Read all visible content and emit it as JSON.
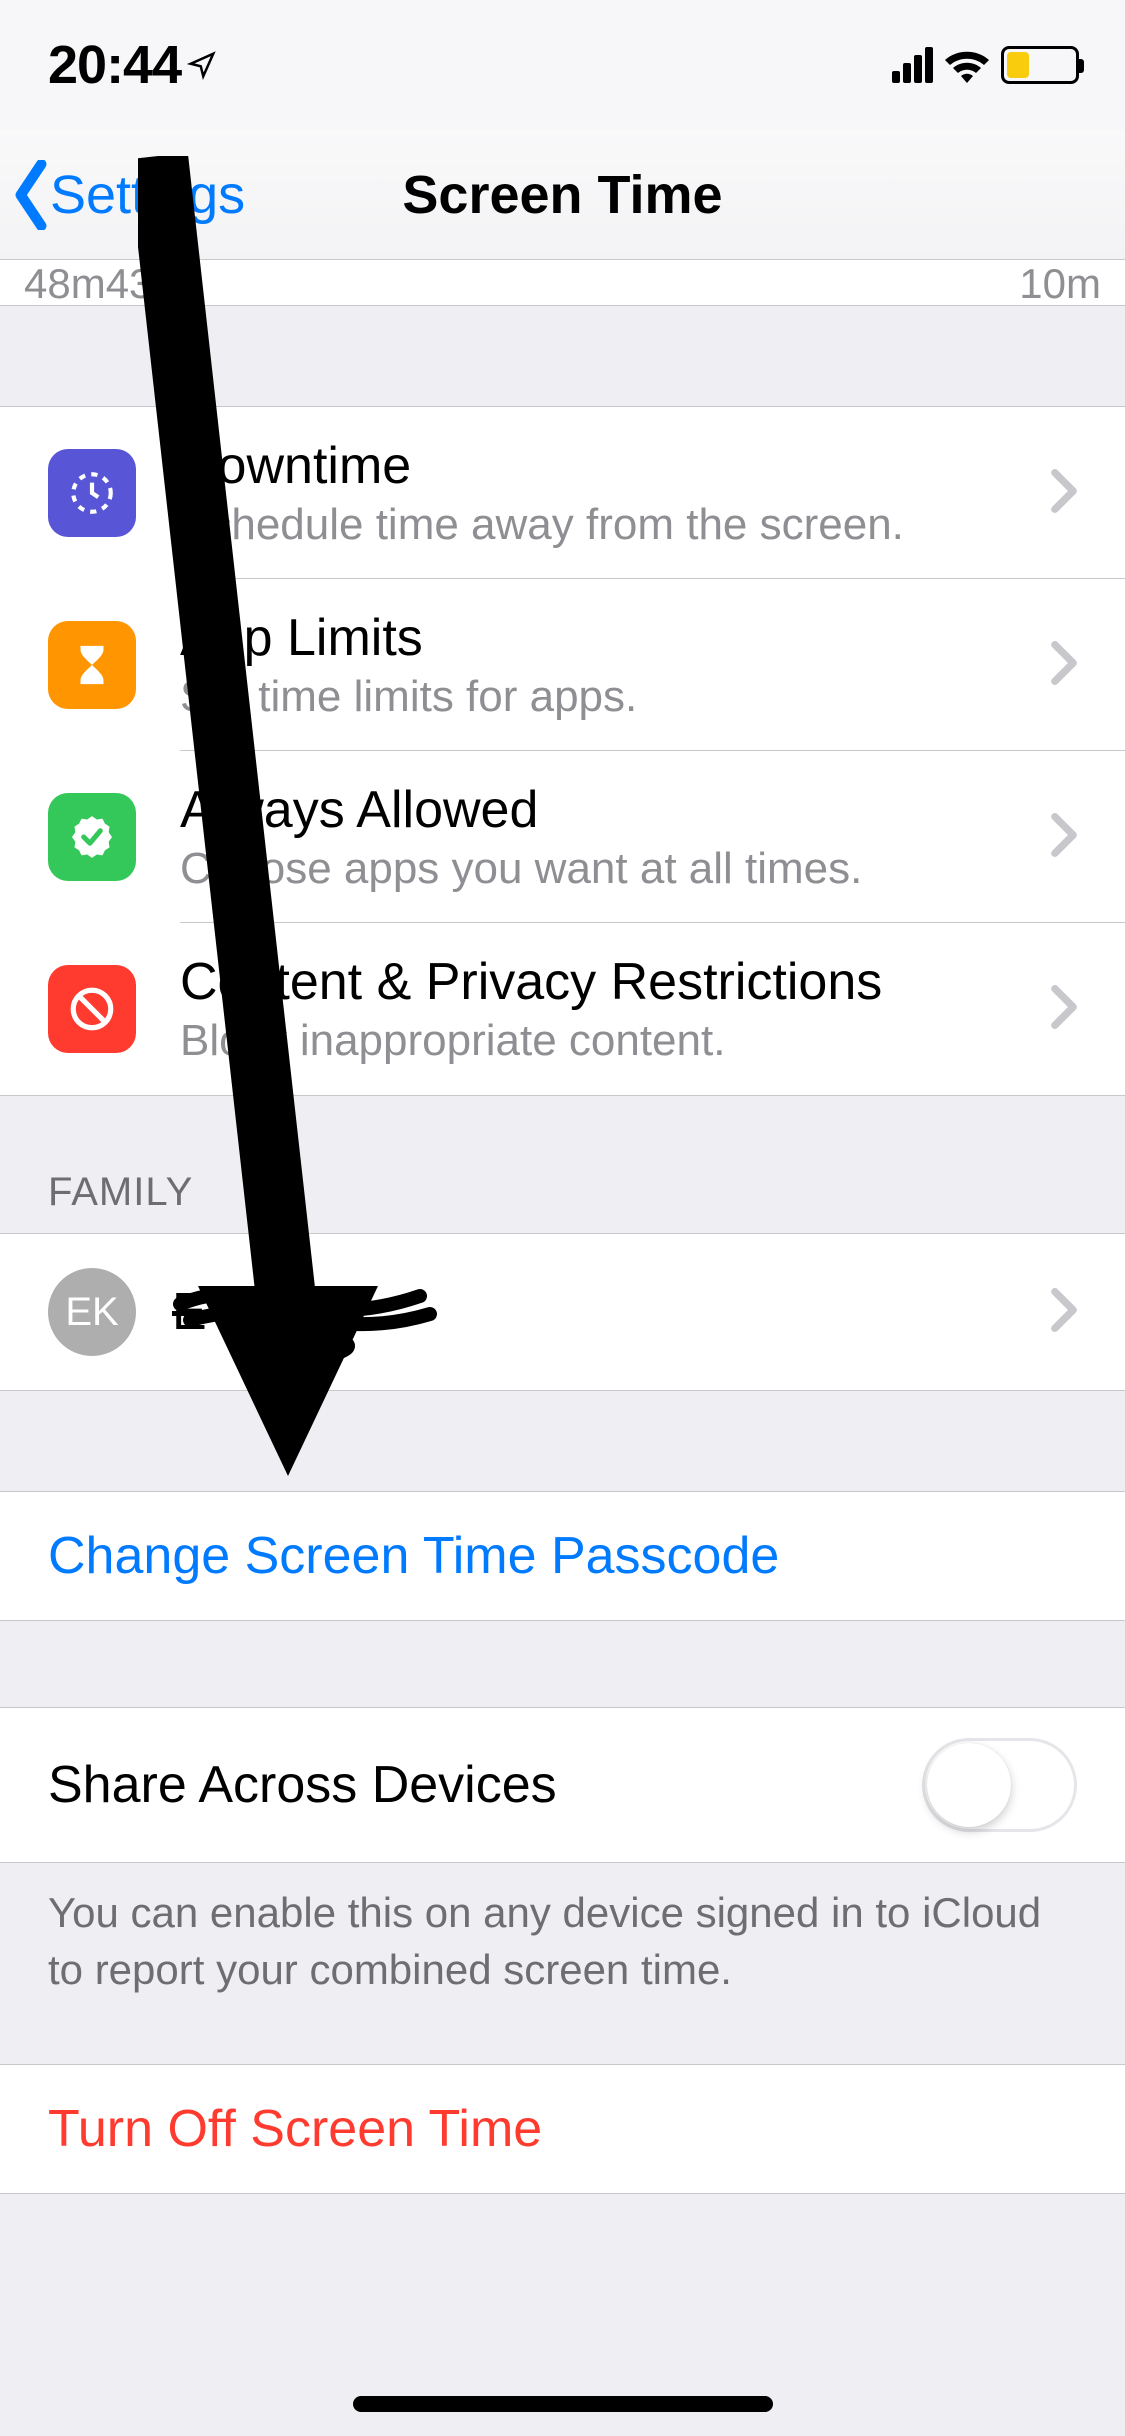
{
  "statusbar": {
    "time": "20:44"
  },
  "nav": {
    "back_label": "Settings",
    "title": "Screen Time"
  },
  "peek": {
    "a": "48m",
    "b": "43m",
    "c": "10m"
  },
  "features": [
    {
      "title": "Downtime",
      "subtitle": "Schedule time away from the screen."
    },
    {
      "title": "App Limits",
      "subtitle": "Set time limits for apps."
    },
    {
      "title": "Always Allowed",
      "subtitle": "Choose apps you want at all times."
    },
    {
      "title": "Content & Privacy Restrictions",
      "subtitle": "Block inappropriate content."
    }
  ],
  "family": {
    "header": "FAMILY",
    "initials": "EK",
    "name": "E--- K---"
  },
  "actions": {
    "change_passcode": "Change Screen Time Passcode",
    "share_label": "Share Across Devices",
    "share_note": "You can enable this on any device signed in to iCloud to report your combined screen time.",
    "turn_off": "Turn Off Screen Time"
  }
}
